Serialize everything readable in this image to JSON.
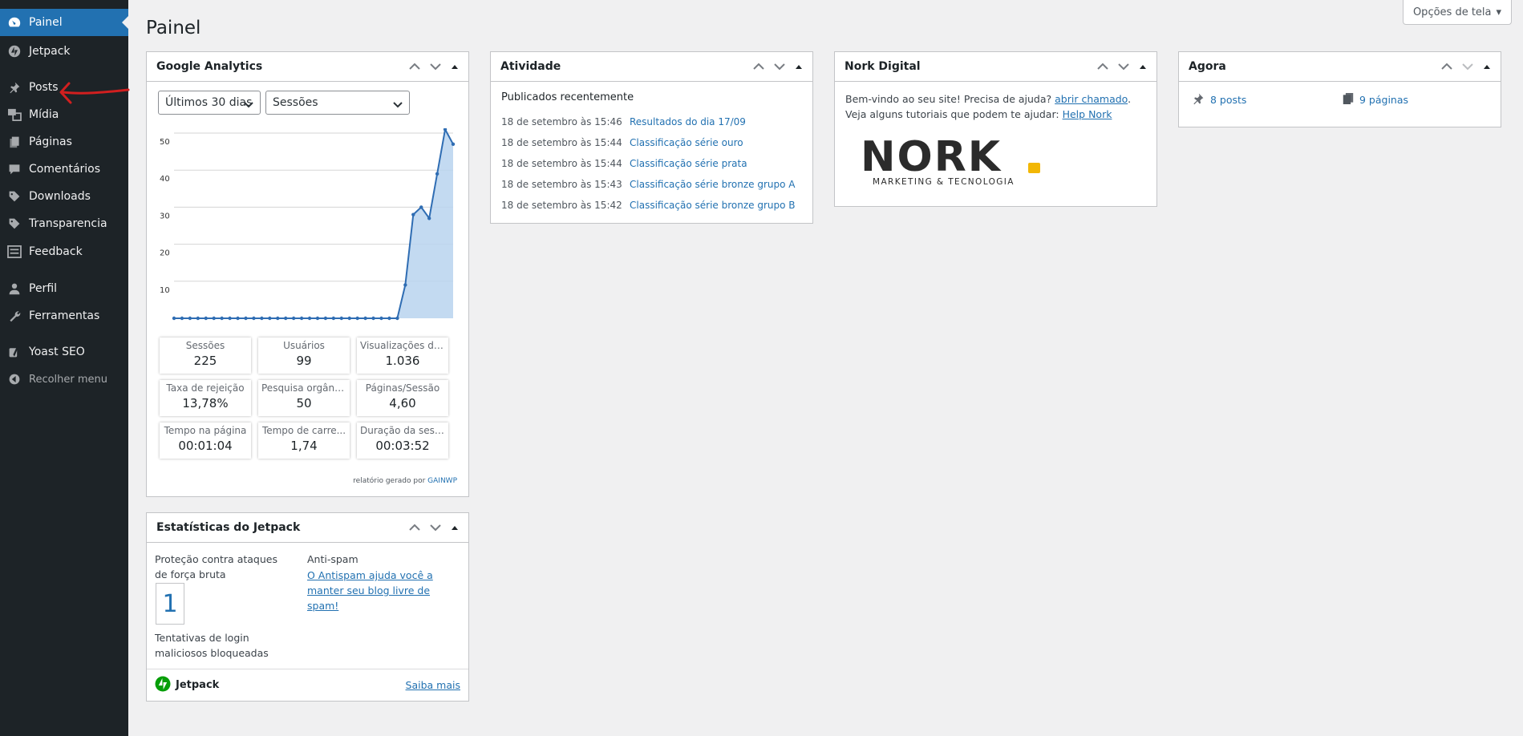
{
  "sidebar": {
    "items": [
      {
        "label": "Painel",
        "icon": "dashboard-icon"
      },
      {
        "label": "Jetpack",
        "icon": "jetpack-icon"
      },
      {
        "label": "Posts",
        "icon": "pin-icon"
      },
      {
        "label": "Mídia",
        "icon": "media-icon"
      },
      {
        "label": "Páginas",
        "icon": "pages-icon"
      },
      {
        "label": "Comentários",
        "icon": "comments-icon"
      },
      {
        "label": "Downloads",
        "icon": "tag-icon"
      },
      {
        "label": "Transparencia",
        "icon": "tag-icon"
      },
      {
        "label": "Feedback",
        "icon": "feedback-icon"
      },
      {
        "label": "Perfil",
        "icon": "user-icon"
      },
      {
        "label": "Ferramentas",
        "icon": "wrench-icon"
      },
      {
        "label": "Yoast SEO",
        "icon": "yoast-icon"
      },
      {
        "label": "Recolher menu",
        "icon": "collapse-icon"
      }
    ],
    "active": "Painel"
  },
  "page": {
    "title": "Painel",
    "screen_options": "Opções de tela"
  },
  "colors": {
    "sidebar_bg": "#1d2327",
    "active": "#2271b1",
    "link": "#2271b1",
    "chart_line": "#2f6db3",
    "chart_fill": "#b9d4ee",
    "annotation_arrow": "#d11f1f"
  },
  "analytics": {
    "title": "Google Analytics",
    "period_select": "Últimos 30 dias",
    "metric_select": "Sessões",
    "stats": [
      {
        "label": "Sessões",
        "value": "225"
      },
      {
        "label": "Usuários",
        "value": "99"
      },
      {
        "label": "Visualizações de...",
        "value": "1.036"
      },
      {
        "label": "Taxa de rejeição",
        "value": "13,78%"
      },
      {
        "label": "Pesquisa orgânica",
        "value": "50"
      },
      {
        "label": "Páginas/Sessão",
        "value": "4,60"
      },
      {
        "label": "Tempo na página",
        "value": "00:01:04"
      },
      {
        "label": "Tempo de carre...",
        "value": "1,74"
      },
      {
        "label": "Duração da sess...",
        "value": "00:03:52"
      }
    ],
    "footer_text": "relatório gerado por",
    "footer_link": "GAINWP"
  },
  "chart_data": {
    "type": "area",
    "title": "",
    "xlabel": "",
    "ylabel": "",
    "ylim": [
      0,
      50
    ],
    "yticks": [
      "10",
      "20",
      "30",
      "40",
      "50"
    ],
    "grid": true,
    "series": [
      {
        "values": [
          0,
          0,
          0,
          0,
          0,
          0,
          0,
          0,
          0,
          0,
          0,
          0,
          0,
          0,
          0,
          0,
          0,
          0,
          0,
          0,
          0,
          0,
          0,
          0,
          0,
          0,
          0,
          0,
          0,
          9,
          28,
          30,
          27,
          39,
          51,
          47
        ]
      }
    ]
  },
  "activity": {
    "title": "Atividade",
    "subtitle": "Publicados recentemente",
    "items": [
      {
        "date": "18 de setembro às 15:46",
        "title": "Resultados do dia 17/09"
      },
      {
        "date": "18 de setembro às 15:44",
        "title": "Classificação série ouro"
      },
      {
        "date": "18 de setembro às 15:44",
        "title": "Classificação série prata"
      },
      {
        "date": "18 de setembro às 15:43",
        "title": "Classificação série bronze grupo A"
      },
      {
        "date": "18 de setembro às 15:42",
        "title": "Classificação série bronze grupo B"
      }
    ]
  },
  "nork": {
    "title": "Nork Digital",
    "text1": "Bem-vindo ao seu site! Precisa de ajuda?",
    "link1": "abrir chamado",
    "text2": ". Veja alguns tutoriais que podem te ajudar:",
    "link2": "Help Nork",
    "logo_word": "NORK",
    "logo_tagline": "MARKETING & TECNOLOGIA",
    "logo_dot_color": "#f2b705"
  },
  "agora": {
    "title": "Agora",
    "posts": "8 posts",
    "pages": "9 páginas"
  },
  "jetpack": {
    "title": "Estatísticas do Jetpack",
    "protect_title": "Proteção contra ataques de força bruta",
    "count": "1",
    "blocked_label": "Tentativas de login maliciosos bloqueadas",
    "antispam_title": "Anti-spam",
    "antispam_link": "O Antispam ajuda você a manter seu blog livre de spam!",
    "brand": "Jetpack",
    "learn_more": "Saiba mais",
    "brand_color": "#069e08"
  }
}
